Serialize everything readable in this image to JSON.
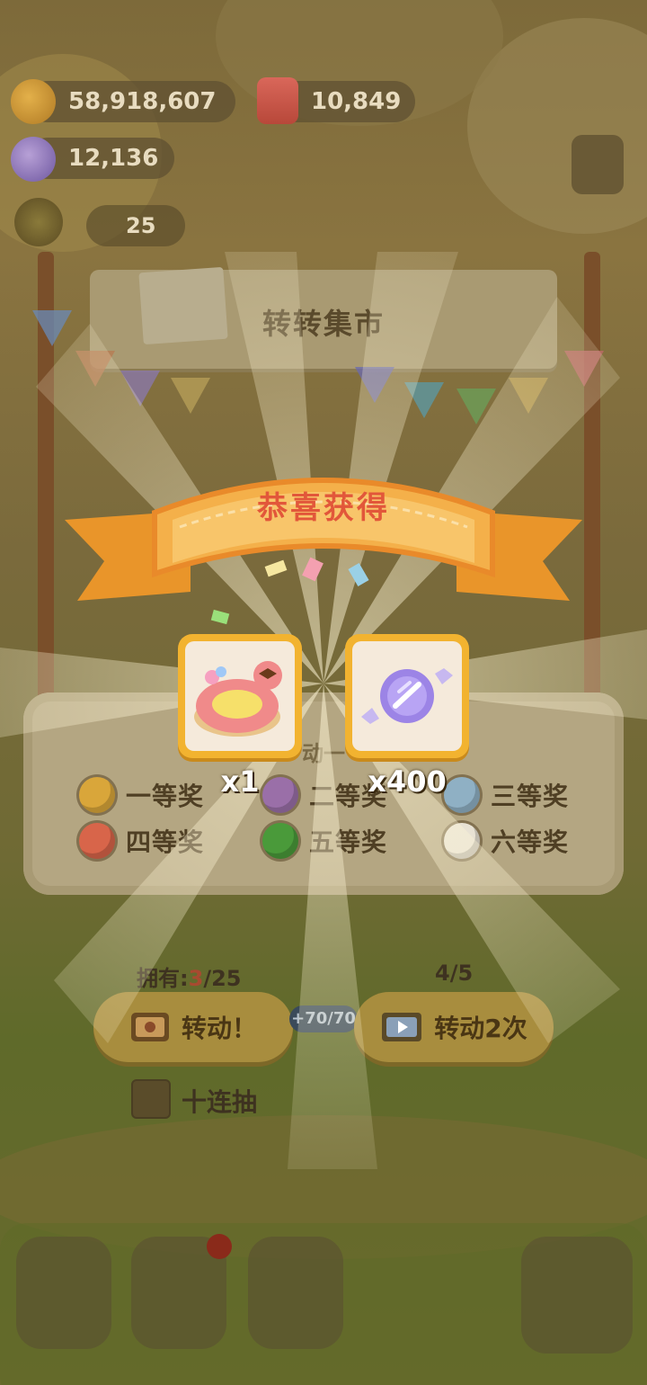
{
  "currencies": {
    "cookies": "58,918,607",
    "gems": "10,849",
    "candy": "12,136",
    "level": "25"
  },
  "market": {
    "title": "转转集市"
  },
  "popup": {
    "title": "恭喜获得",
    "rewards": [
      {
        "icon": "flamingo-cake-icon",
        "qty": "x1"
      },
      {
        "icon": "purple-candy-icon",
        "qty": "x400"
      }
    ]
  },
  "prizes": [
    {
      "label": "一等奖",
      "color": "#d9a63a"
    },
    {
      "label": "二等奖",
      "color": "#9a6fa8"
    },
    {
      "label": "三等奖",
      "color": "#8fb0c4"
    },
    {
      "label": "四等奖",
      "color": "#d8654a"
    },
    {
      "label": "五等奖",
      "color": "#4a9a3a"
    },
    {
      "label": "六等奖",
      "color": "#e8e2d4"
    }
  ],
  "table_hint": "动一",
  "spin": {
    "owned_prefix": "拥有:",
    "owned_current": "3",
    "owned_total": "/25",
    "ad_count": "4/5",
    "spin_label": "转动！",
    "spin_twice_label": "转动2次",
    "energy": "+70/70"
  },
  "ten_draw_label": "十连抽",
  "colors": {
    "banner": "#f3a63a",
    "card_border": "#f2b330",
    "title_red": "#e2573a"
  }
}
